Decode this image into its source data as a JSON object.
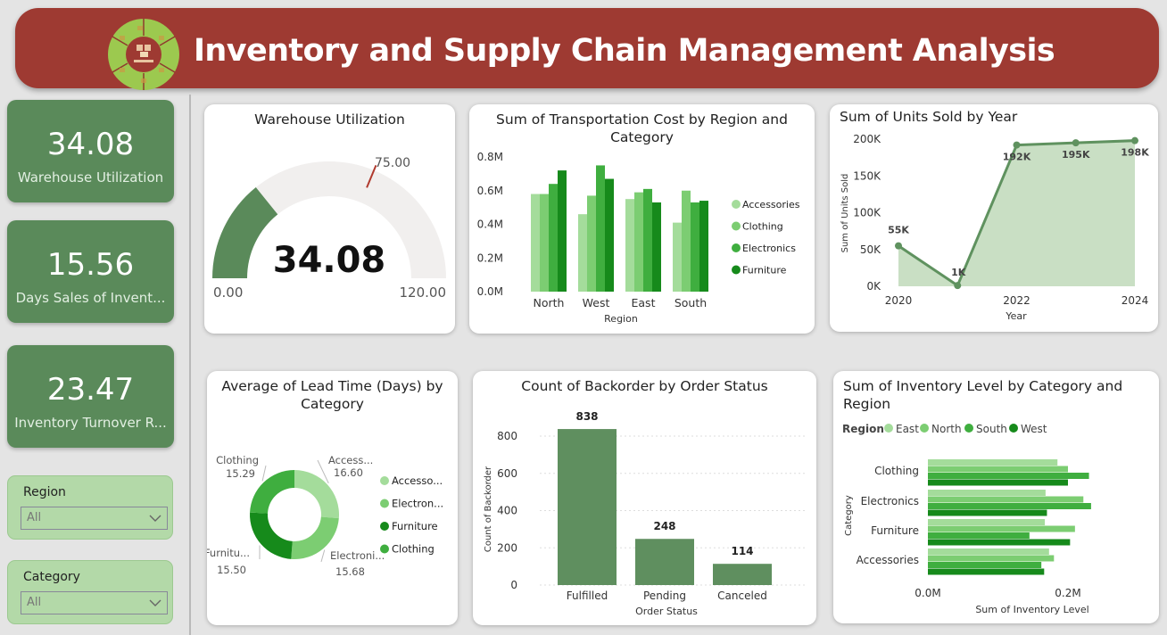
{
  "header": {
    "title": "Inventory and Supply Chain Management Analysis"
  },
  "kpis": [
    {
      "value": "34.08",
      "label": "Warehouse Utilization"
    },
    {
      "value": "15.56",
      "label": "Days Sales of Invent..."
    },
    {
      "value": "23.47",
      "label": "Inventory Turnover R..."
    }
  ],
  "slicers": [
    {
      "title": "Region",
      "value": "All"
    },
    {
      "title": "Category",
      "value": "All"
    }
  ],
  "colors": {
    "c1": "#a4dc9b",
    "c2": "#7ccd72",
    "c3": "#3fae3f",
    "c4": "#168a1b",
    "kpi": "#5a8a5a",
    "banner": "#9e3a32"
  },
  "gauge": {
    "title": "Warehouse Utilization",
    "value": 34.08,
    "value_label": "34.08",
    "min": 0,
    "max": 120,
    "target": 75,
    "min_label": "0.00",
    "max_label": "120.00",
    "target_label": "75.00"
  },
  "transport": {
    "title": "Sum of Transportation Cost by Region and Category",
    "xlabel": "Region",
    "yticks": [
      "0.0M",
      "0.2M",
      "0.4M",
      "0.6M",
      "0.8M"
    ],
    "chart_data": {
      "type": "bar",
      "categories": [
        "North",
        "West",
        "East",
        "South"
      ],
      "series": [
        {
          "name": "Accessories",
          "values": [
            0.58,
            0.46,
            0.55,
            0.41
          ]
        },
        {
          "name": "Clothing",
          "values": [
            0.58,
            0.57,
            0.59,
            0.6
          ]
        },
        {
          "name": "Electronics",
          "values": [
            0.64,
            0.75,
            0.61,
            0.53
          ]
        },
        {
          "name": "Furniture",
          "values": [
            0.72,
            0.67,
            0.53,
            0.54
          ]
        }
      ],
      "ylim": [
        0,
        0.8
      ]
    }
  },
  "units": {
    "title": "Sum of Units Sold by Year",
    "xlabel": "Year",
    "ylabel": "Sum of Units Sold",
    "yticks": [
      "0K",
      "50K",
      "100K",
      "150K",
      "200K"
    ],
    "xticks": [
      "2020",
      "2022",
      "2024"
    ],
    "chart_data": {
      "type": "area",
      "x": [
        2020,
        2021,
        2022,
        2023,
        2024
      ],
      "values": [
        55,
        1,
        192,
        195,
        198
      ],
      "labels": [
        "55K",
        "1K",
        "192K",
        "195K",
        "198K"
      ],
      "ylim": [
        0,
        200
      ]
    }
  },
  "lead": {
    "title": "Average of Lead Time (Days) by Category",
    "chart_data": {
      "type": "pie",
      "legend": [
        "Accesso...",
        "Electron...",
        "Furniture",
        "Clothing"
      ],
      "slices": [
        {
          "name": "Accessories",
          "value": 16.6,
          "name_label": "Access...",
          "value_label": "16.60"
        },
        {
          "name": "Electronics",
          "value": 15.68,
          "name_label": "Electroni...",
          "value_label": "15.68"
        },
        {
          "name": "Furniture",
          "value": 15.5,
          "name_label": "Furnitu...",
          "value_label": "15.50"
        },
        {
          "name": "Clothing",
          "value": 15.29,
          "name_label": "Clothing",
          "value_label": "15.29"
        }
      ]
    }
  },
  "backorder": {
    "title": "Count of Backorder by Order Status",
    "xlabel": "Order Status",
    "ylabel": "Count of Backorder",
    "yticks": [
      "0",
      "200",
      "400",
      "600",
      "800"
    ],
    "chart_data": {
      "type": "bar",
      "categories": [
        "Fulfilled",
        "Pending",
        "Canceled"
      ],
      "values": [
        838,
        248,
        114
      ],
      "ylim": [
        0,
        900
      ]
    }
  },
  "inventory": {
    "title": "Sum of Inventory Level by Category and Region",
    "legend_title": "Region",
    "xlabel": "Sum of Inventory Level",
    "ylabel": "Category",
    "xticks": [
      "0.0M",
      "0.2M"
    ],
    "chart_data": {
      "type": "bar",
      "orientation": "horizontal",
      "categories": [
        "Clothing",
        "Electronics",
        "Furniture",
        "Accessories"
      ],
      "series": [
        {
          "name": "East",
          "values": [
            0.185,
            0.168,
            0.167,
            0.173
          ]
        },
        {
          "name": "North",
          "values": [
            0.2,
            0.222,
            0.21,
            0.18
          ]
        },
        {
          "name": "South",
          "values": [
            0.23,
            0.233,
            0.145,
            0.162
          ]
        },
        {
          "name": "West",
          "values": [
            0.2,
            0.17,
            0.203,
            0.166
          ]
        }
      ],
      "xlim": [
        0,
        0.24
      ]
    }
  }
}
